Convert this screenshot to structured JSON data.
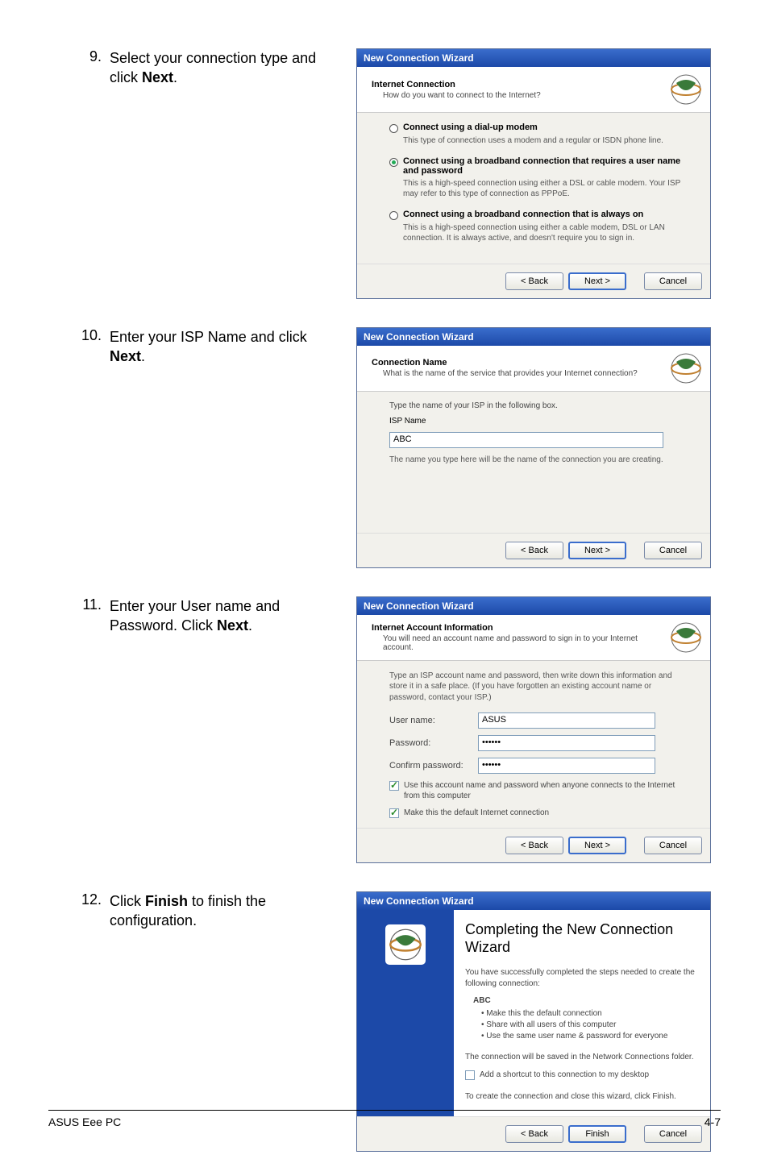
{
  "steps": {
    "s9": {
      "num": "9.",
      "desc_a": "Select your connection type and click ",
      "desc_b": "Next",
      "desc_c": "."
    },
    "s10": {
      "num": "10.",
      "desc_a": "Enter your ISP Name and click ",
      "desc_b": "Next",
      "desc_c": "."
    },
    "s11": {
      "num": "11.",
      "desc_a": "Enter your User name and Password. Click ",
      "desc_b": "Next",
      "desc_c": "."
    },
    "s12": {
      "num": "12.",
      "desc_a": "Click ",
      "desc_b": "Finish",
      "desc_c": " to finish the configuration."
    }
  },
  "dlg1": {
    "title": "New Connection Wizard",
    "header": "Internet Connection",
    "header_sub": "How do you want to connect to the Internet?",
    "opt1_title": "Connect using a dial-up modem",
    "opt1_desc": "This type of connection uses a modem and a regular or ISDN phone line.",
    "opt2_title": "Connect using a broadband connection that requires a user name and password",
    "opt2_desc": "This is a high-speed connection using either a DSL or cable modem. Your ISP may refer to this type of connection as PPPoE.",
    "opt3_title": "Connect using a broadband connection that is always on",
    "opt3_desc": "This is a high-speed connection using either a cable modem, DSL or LAN connection. It is always active, and doesn't require you to sign in.",
    "back": "< Back",
    "next": "Next >",
    "cancel": "Cancel"
  },
  "dlg2": {
    "title": "New Connection Wizard",
    "header": "Connection Name",
    "header_sub": "What is the name of the service that provides your Internet connection?",
    "prompt": "Type the name of your ISP in the following box.",
    "label": "ISP Name",
    "value": "ABC",
    "note": "The name you type here will be the name of the connection you are creating.",
    "back": "< Back",
    "next": "Next >",
    "cancel": "Cancel"
  },
  "dlg3": {
    "title": "New Connection Wizard",
    "header": "Internet Account Information",
    "header_sub": "You will need an account name and password to sign in to your Internet account.",
    "intro": "Type an ISP account name and password, then write down this information and store it in a safe place. (If you have forgotten an existing account name or password, contact your ISP.)",
    "user_label": "User name:",
    "user_value": "ASUS",
    "pass_label": "Password:",
    "pass_value": "••••••",
    "conf_label": "Confirm password:",
    "conf_value": "••••••",
    "cb1": "Use this account name and password when anyone connects to the Internet from this computer",
    "cb2": "Make this the default Internet connection",
    "back": "< Back",
    "next": "Next >",
    "cancel": "Cancel"
  },
  "dlg4": {
    "title": "New Connection Wizard",
    "heading": "Completing the New Connection Wizard",
    "intro": "You have successfully completed the steps needed to create the following connection:",
    "conn_name": "ABC",
    "b1": "• Make this the default connection",
    "b2": "• Share with all users of this computer",
    "b3": "• Use the same user name & password for everyone",
    "saved": "The connection will be saved in the Network Connections folder.",
    "cb": "Add a shortcut to this connection to my desktop",
    "close_text": "To create the connection and close this wizard, click Finish.",
    "back": "< Back",
    "finish": "Finish",
    "cancel": "Cancel"
  },
  "footer": {
    "left": "ASUS Eee PC",
    "right": "4-7"
  }
}
